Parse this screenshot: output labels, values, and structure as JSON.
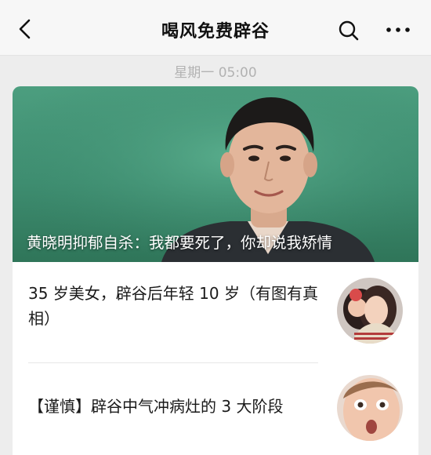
{
  "nav": {
    "title": "喝风免费辟谷",
    "icons": {
      "back": "chevron-left-icon",
      "search": "search-icon",
      "more": "more-dots-icon"
    }
  },
  "timestamp": "星期一 05:00",
  "articles": {
    "cover": {
      "title": "黄晓明抑郁自杀：我都要死了，你却说我矫情",
      "background_color": "#3e8d70"
    },
    "items": [
      {
        "title": "35 岁美女，辟谷后年轻 10 岁（有图有真相）"
      },
      {
        "title": "【谨慎】辟谷中气冲病灶的 3 大阶段"
      }
    ]
  }
}
